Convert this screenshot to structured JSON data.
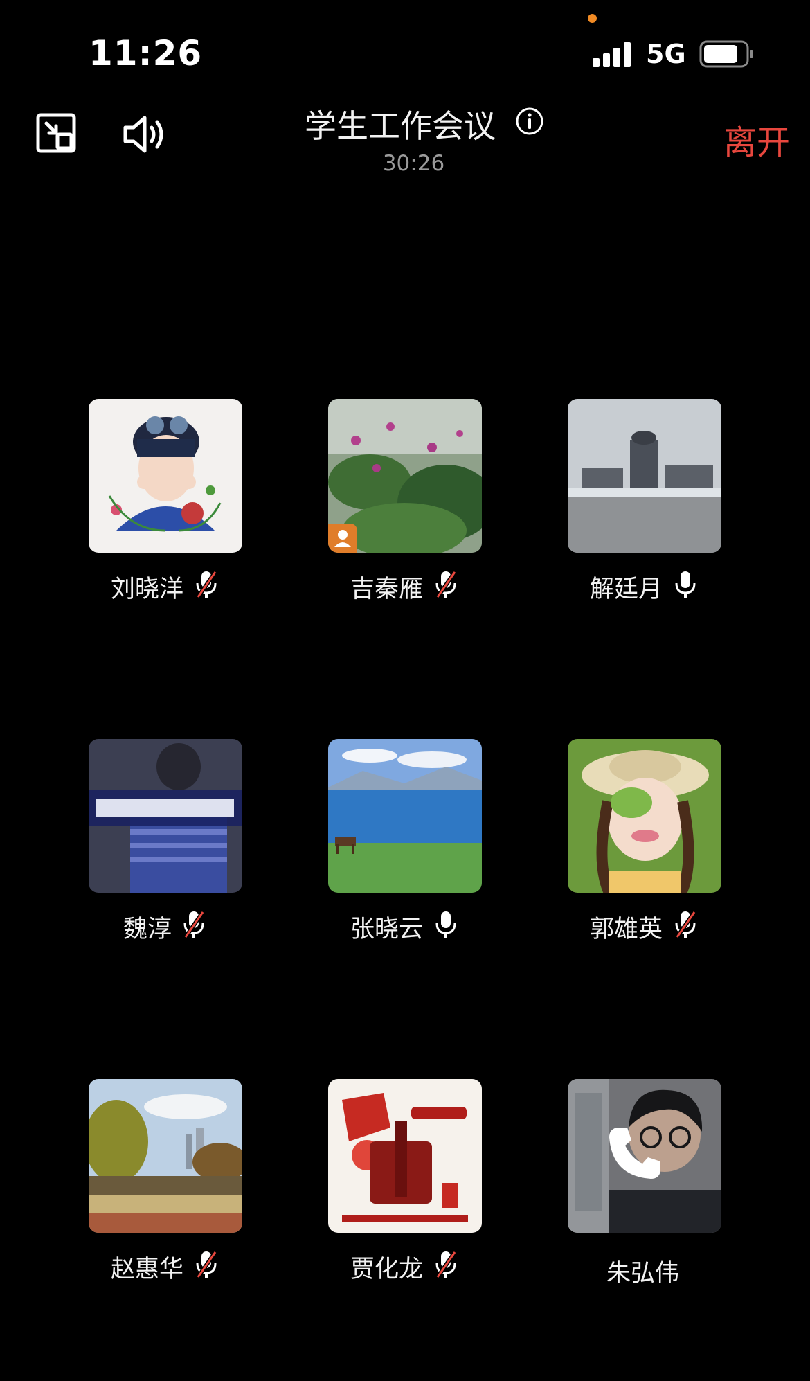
{
  "status_bar": {
    "time": "11:26",
    "network": "5G"
  },
  "header": {
    "title": "学生工作会议",
    "duration": "30:26",
    "leave_label": "离开"
  },
  "participants": [
    {
      "name": "刘晓洋",
      "mic": "muted"
    },
    {
      "name": "吉秦雁",
      "mic": "muted",
      "badge": "host"
    },
    {
      "name": "解廷月",
      "mic": "on"
    },
    {
      "name": "魏淳",
      "mic": "muted"
    },
    {
      "name": "张晓云",
      "mic": "on"
    },
    {
      "name": "郭雄英",
      "mic": "muted"
    },
    {
      "name": "赵惠华",
      "mic": "muted"
    },
    {
      "name": "贾化龙",
      "mic": "muted"
    },
    {
      "name": "朱弘伟",
      "mic": "calling"
    }
  ],
  "colors": {
    "leave": "#e8473e",
    "host_badge": "#e07d2a",
    "mute_slash": "#e8473e"
  },
  "icons": [
    "picture-in-picture-icon",
    "speaker-icon",
    "info-icon",
    "mic-icon",
    "mic-muted-icon",
    "phone-icon",
    "host-badge-icon"
  ]
}
